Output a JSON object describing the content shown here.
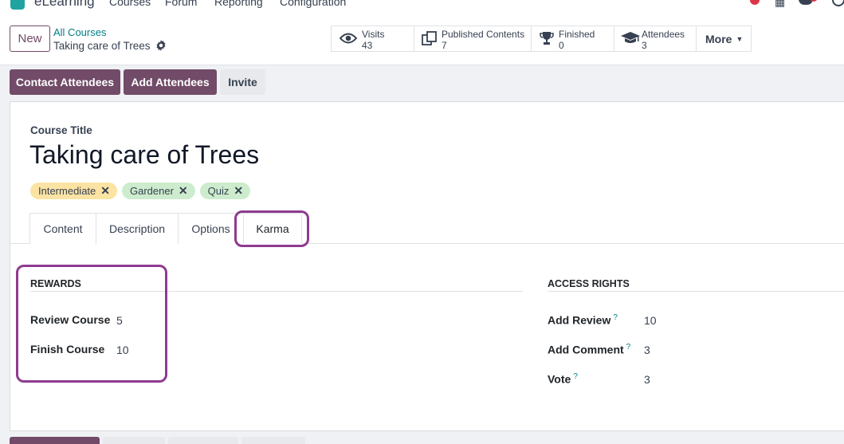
{
  "topnav": {
    "app_name": "eLearning",
    "menus": [
      "Courses",
      "Forum",
      "Reporting",
      "Configuration"
    ],
    "icons": [
      "activity-dot-icon",
      "apps-grid-icon",
      "chat-icon",
      "clock-icon"
    ]
  },
  "control": {
    "new_label": "New",
    "breadcrumb": "All Courses",
    "record_name": "Taking care of Trees",
    "stats": [
      {
        "label": "Visits",
        "value": "43"
      },
      {
        "label": "Published Contents",
        "value": "7"
      },
      {
        "label": "Finished",
        "value": "0"
      },
      {
        "label": "Attendees",
        "value": "3"
      }
    ],
    "more_label": "More"
  },
  "actions": {
    "contact": "Contact Attendees",
    "add": "Add Attendees",
    "invite": "Invite"
  },
  "form": {
    "course_title_label": "Course Title",
    "course_title": "Taking care of Trees",
    "tags": [
      {
        "label": "Intermediate",
        "color": "#fbe3a3"
      },
      {
        "label": "Gardener",
        "color": "#cdeccd"
      },
      {
        "label": "Quiz",
        "color": "#cdeccd"
      }
    ],
    "tabs": [
      "Content",
      "Description",
      "Options",
      "Karma"
    ],
    "active_tab": "Karma"
  },
  "rewards": {
    "title": "REWARDS",
    "fields": [
      {
        "label": "Review Course",
        "value": "5"
      },
      {
        "label": "Finish Course",
        "value": "10"
      }
    ]
  },
  "access": {
    "title": "ACCESS RIGHTS",
    "fields": [
      {
        "label": "Add Review",
        "value": "10"
      },
      {
        "label": "Add Comment",
        "value": "3"
      },
      {
        "label": "Vote",
        "value": "3"
      }
    ],
    "help_mark": "?"
  },
  "colors": {
    "primary": "#714b67",
    "link": "#017e84",
    "highlight": "#8e3b90"
  }
}
